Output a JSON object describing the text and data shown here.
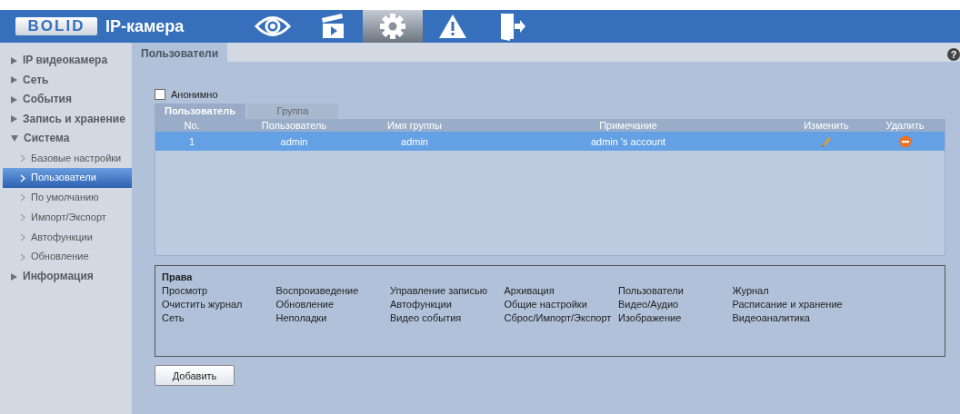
{
  "header": {
    "logo": "BOLID",
    "title": "IP-камера",
    "nav": [
      {
        "kind": "eye",
        "selected": false
      },
      {
        "kind": "clapper",
        "selected": false
      },
      {
        "kind": "gear",
        "selected": true
      },
      {
        "kind": "warning",
        "selected": false
      },
      {
        "kind": "exit",
        "selected": false
      }
    ]
  },
  "sidebar": {
    "items": [
      {
        "label": "IP видеокамера",
        "expanded": false
      },
      {
        "label": "Сеть",
        "expanded": false
      },
      {
        "label": "События",
        "expanded": false
      },
      {
        "label": "Запись и хранение",
        "expanded": false
      },
      {
        "label": "Система",
        "expanded": true,
        "children": [
          {
            "label": "Базовые настройки",
            "selected": false
          },
          {
            "label": "Пользователи",
            "selected": true
          },
          {
            "label": "По умолчанию",
            "selected": false
          },
          {
            "label": "Импорт/Экспорт",
            "selected": false
          },
          {
            "label": "Автофункции",
            "selected": false
          },
          {
            "label": "Обновление",
            "selected": false
          }
        ]
      },
      {
        "label": "Информация",
        "expanded": false
      }
    ]
  },
  "page_tab": "Пользователи",
  "help": "?",
  "anonymous": {
    "label": "Анонимно",
    "checked": false
  },
  "subtabs": [
    {
      "label": "Пользователь",
      "selected": true
    },
    {
      "label": "Группа",
      "selected": false
    }
  ],
  "table": {
    "columns": [
      "No.",
      "Пользователь",
      "Имя группы",
      "Примечание",
      "Изменить",
      "Удалить"
    ],
    "rows": [
      {
        "no": "1",
        "user": "admin",
        "group": "admin",
        "note": "admin 's account",
        "selected": true
      }
    ]
  },
  "rights": {
    "title": "Права",
    "items": [
      "Просмотр",
      "Воспроизведение",
      "Управление записью",
      "Архивация",
      "Пользователи",
      "Журнал",
      "Очистить журнал",
      "Обновление",
      "Автофункции",
      "Общие настройки",
      "Видео/Аудио",
      "Расписание и хранение",
      "Сеть",
      "Неполадки",
      "Видео события",
      "Сброс/Импорт/Экспорт",
      "Изображение",
      "Видеоаналитика"
    ]
  },
  "add_button": "Добавить"
}
